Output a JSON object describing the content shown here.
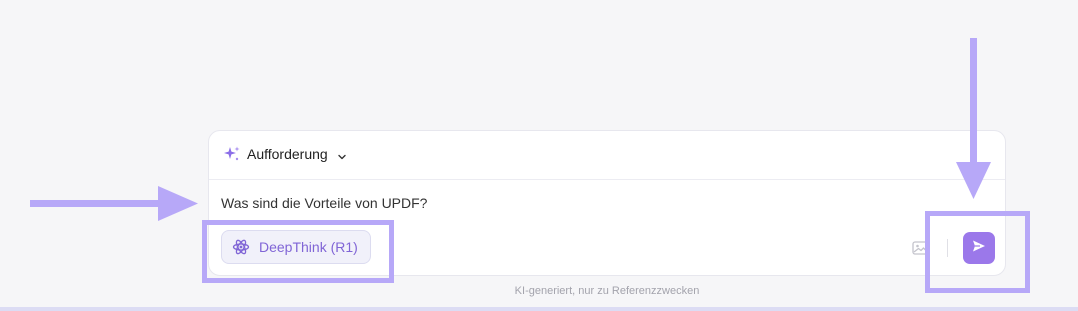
{
  "prompt_selector": {
    "label": "Aufforderung",
    "icon": "sparkle-icon"
  },
  "message": {
    "text": "Was sind die Vorteile von UPDF?"
  },
  "deepthink": {
    "label": "DeepThink (R1)",
    "icon": "atom-icon"
  },
  "actions": {
    "upload_icon": "image-icon",
    "send_icon": "send-icon"
  },
  "footer": {
    "disclaimer": "KI-generiert, nur zu Referenzzwecken"
  },
  "colors": {
    "accent": "#9b78ea",
    "deepthink_text": "#8065d6",
    "annotation": "#b7a8f8"
  }
}
